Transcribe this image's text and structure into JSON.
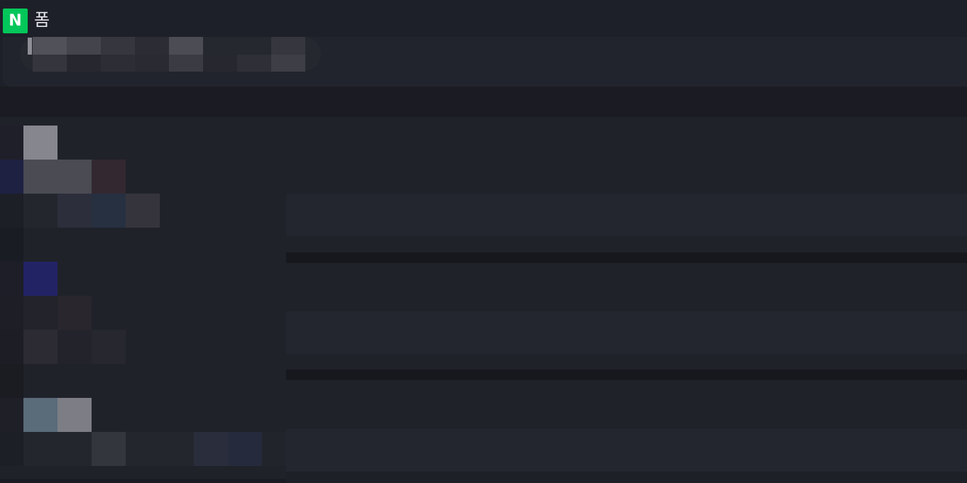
{
  "app": {
    "logo_letter": "N",
    "title": "폼",
    "brand_color": "#03c75a"
  },
  "icons": {
    "logo": "naver-n-logo"
  },
  "theme": {
    "background": "#1e2029",
    "panel": "#22242d"
  }
}
